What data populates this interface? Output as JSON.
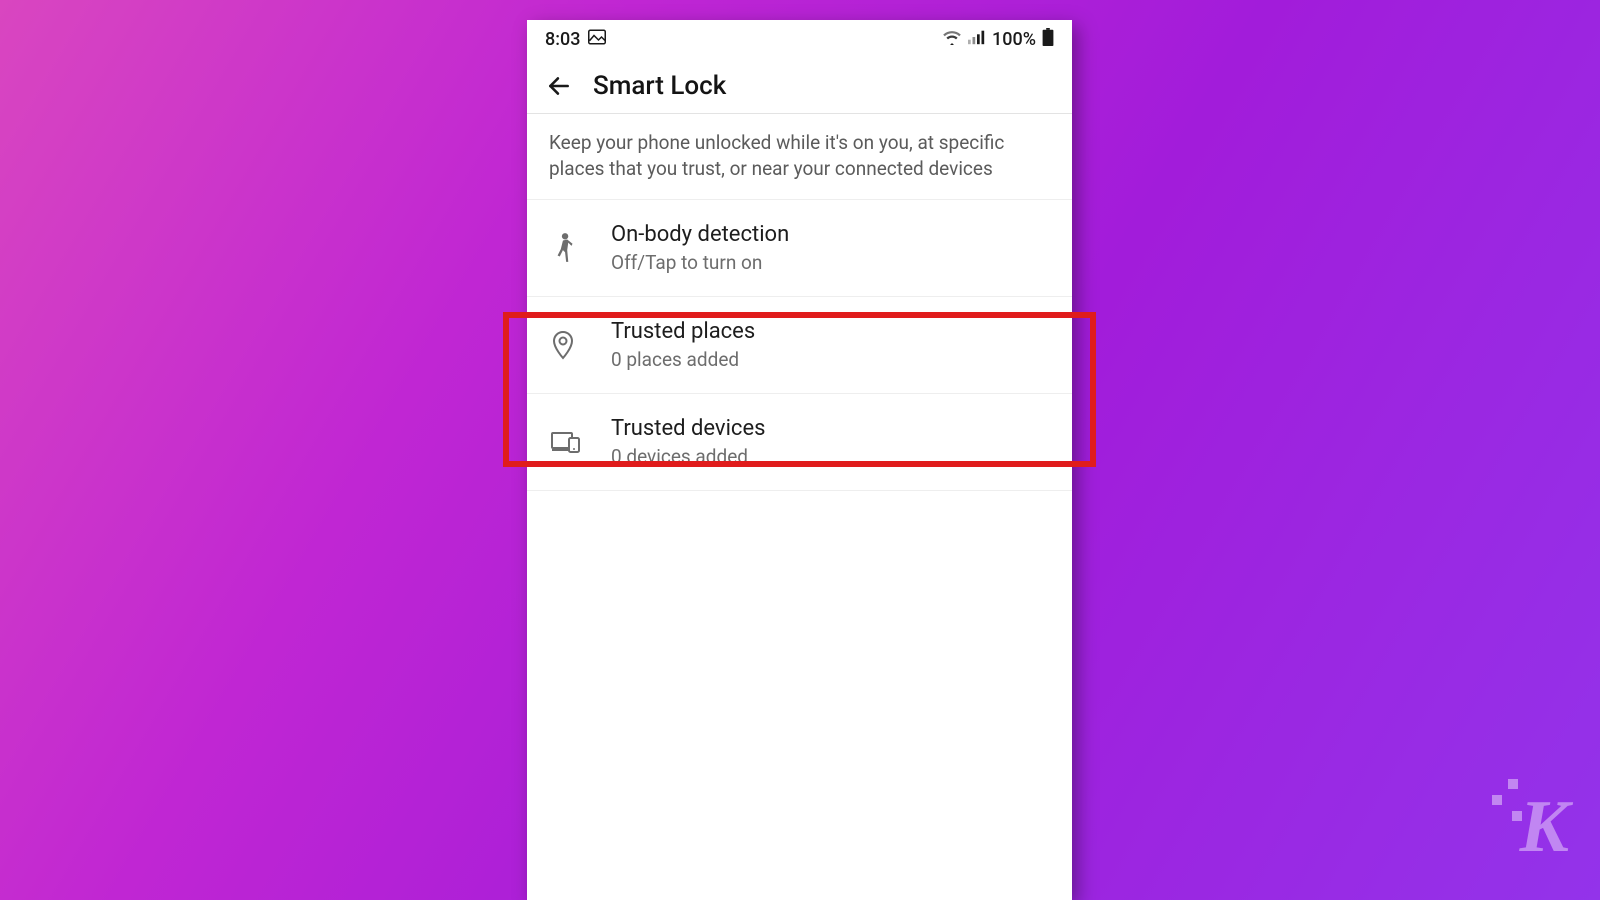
{
  "statusbar": {
    "time": "8:03",
    "battery_text": "100%"
  },
  "header": {
    "title": "Smart Lock"
  },
  "description": "Keep your phone unlocked while it's on you, at specific places that you trust, or near your connected devices",
  "items": [
    {
      "title": "On-body detection",
      "subtitle": "Off/Tap to turn on"
    },
    {
      "title": "Trusted places",
      "subtitle": "0 places added"
    },
    {
      "title": "Trusted devices",
      "subtitle": "0 devices added"
    }
  ],
  "highlight": {
    "item_index": 1,
    "color": "#e01c1c"
  },
  "watermark": "K"
}
